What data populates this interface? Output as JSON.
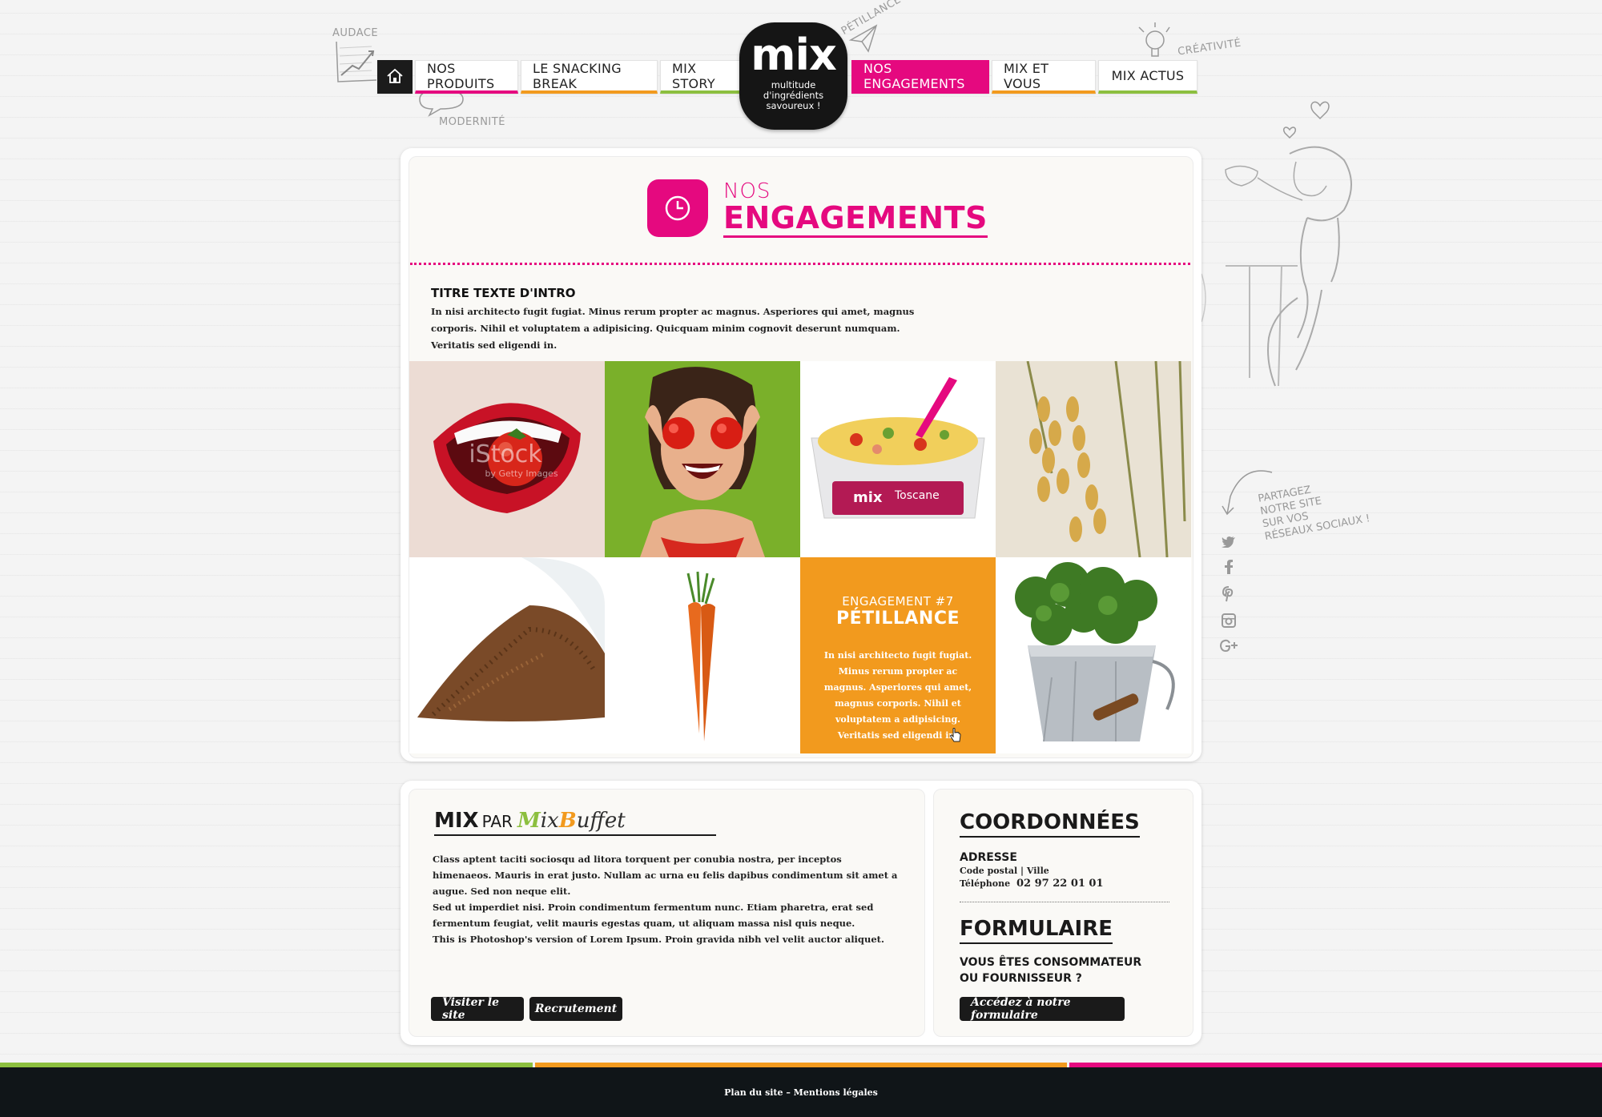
{
  "colors": {
    "brand_pink": "#e5097f",
    "orange": "#f29a1e",
    "green": "#8cbf3f",
    "dark": "#101518"
  },
  "doodles": {
    "audace": "AUDACE",
    "modernite": "MODERNITÉ",
    "petillance": "PÉTILLANCE",
    "creativite": "CRÉATIVITÉ"
  },
  "logo": {
    "name": "mix",
    "tagline_1": "multitude",
    "tagline_2": "d'ingrédients",
    "tagline_3": "savoureux !"
  },
  "nav": {
    "home_icon": "home-icon",
    "left": [
      {
        "label": "NOS PRODUITS",
        "underline": "#e5097f"
      },
      {
        "label": "LE SNACKING BREAK",
        "underline": "#f29a1e"
      },
      {
        "label": "MIX STORY",
        "underline": "#8cbf3f"
      }
    ],
    "right": [
      {
        "label": "NOS ENGAGEMENTS",
        "underline": "#e5097f",
        "active": true
      },
      {
        "label": "MIX ET VOUS",
        "underline": "#f29a1e"
      },
      {
        "label": "MIX ACTUS",
        "underline": "#8cbf3f"
      }
    ]
  },
  "page": {
    "title_small": "NOS",
    "title_big": "ENGAGEMENTS",
    "title_icon": "clock-icon"
  },
  "intro": {
    "title": "TITRE TEXTE D'INTRO",
    "text": "In nisi architecto fugit fugiat. Minus rerum propter ac magnus. Asperiores qui amet, magnus corporis. Nihil et voluptatem a adipisicing. Quicquam minim cognovit deserunt numquam. Veritatis sed eligendi in."
  },
  "tiles": {
    "mouth_watermark": "iStock",
    "mouth_watermark_sub": "by Getty Images",
    "box_brand": "mix",
    "box_label": "Toscane",
    "highlight": {
      "sub": "ENGAGEMENT #7",
      "title": "PÉTILLANCE",
      "text": "In nisi architecto fugit fugiat. Minus rerum propter ac magnus. Asperiores qui amet, magnus corporis. Nihil et voluptatem a adipisicing. Veritatis sed eligendi in."
    }
  },
  "share": {
    "text_1": "PARTAGEZ",
    "text_2": "NOTRE SITE",
    "text_3": "SUR VOS",
    "text_4": "RÉSEAUX SOCIAUX !"
  },
  "social": {
    "twitter": "twitter-icon",
    "facebook": "facebook-icon",
    "pinterest": "pinterest-icon",
    "instagram": "instagram-icon",
    "gplus": "google-plus-icon"
  },
  "mixbuffet": {
    "mix": "MIX",
    "par": "PAR",
    "buffet_m": "M",
    "buffet_ix": "ix",
    "buffet_b": "B",
    "buffet_rest": "uffet",
    "p1": "Class aptent taciti sociosqu ad litora torquent per conubia nostra, per inceptos himenaeos. Mauris in erat justo. Nullam ac urna eu felis dapibus condimentum sit amet a augue. Sed non neque elit.",
    "p2": "Sed ut imperdiet nisi. Proin condimentum fermentum nunc. Etiam pharetra, erat sed fermentum feugiat, velit mauris egestas quam, ut aliquam massa nisl quis neque.",
    "p3": "This is Photoshop's version  of Lorem Ipsum. Proin gravida nibh vel velit auctor aliquet.",
    "btn_visit": "Visiter le site",
    "btn_recruit": "Recrutement"
  },
  "coord": {
    "title": "COORDONNÉES",
    "adresse": "ADRESSE",
    "code_ville": "Code postal  |  Ville",
    "tel_label": "Téléphone",
    "tel": "02 97 22 01 01",
    "form_title": "FORMULAIRE",
    "form_q1": "VOUS ÊTES CONSOMMATEUR",
    "form_q2": "OU FOURNISSEUR ?",
    "form_btn": "Accédez à notre formulaire"
  },
  "footer": {
    "text": "Plan du site – Mentions légales"
  }
}
